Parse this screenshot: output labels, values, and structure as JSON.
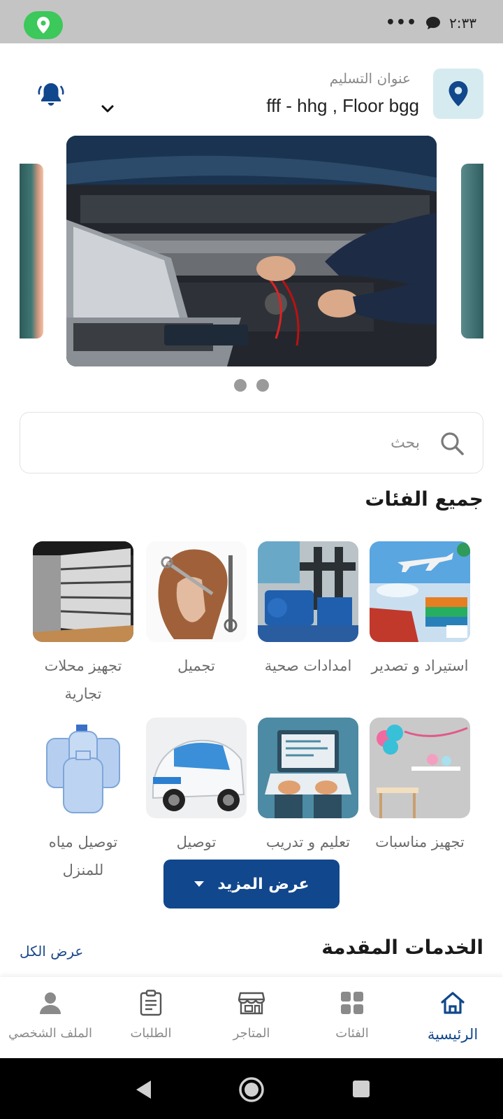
{
  "status_bar": {
    "time": "٢:٣٣",
    "more_dots": "•••",
    "location_badge_icon": "location-pin-icon"
  },
  "header": {
    "address_label": "عنوان التسليم",
    "address_value": "fff - hhg , Floor bgg",
    "notification_icon": "bell-icon",
    "location_icon": "location-pin-icon"
  },
  "carousel": {
    "slide_count": 2
  },
  "search": {
    "placeholder": "بحث"
  },
  "categories": {
    "title": "جميع الفئات",
    "items": [
      {
        "label": "استيراد و تصدير"
      },
      {
        "label": "امدادات صحية"
      },
      {
        "label": "تجميل"
      },
      {
        "label": "تجهيز محلات تجارية"
      },
      {
        "label": "تجهيز مناسبات"
      },
      {
        "label": "تعليم و تدريب"
      },
      {
        "label": "توصيل"
      },
      {
        "label": "توصيل مياه للمنزل"
      }
    ],
    "more_button": "عرض المزيد"
  },
  "services": {
    "title": "الخدمات المقدمة",
    "view_all": "عرض الكل"
  },
  "bottom_nav": {
    "items": [
      {
        "label": "الرئيسية",
        "icon": "home-icon",
        "active": true
      },
      {
        "label": "الفئات",
        "icon": "grid-icon",
        "active": false
      },
      {
        "label": "المتاجر",
        "icon": "store-icon",
        "active": false
      },
      {
        "label": "الطلبات",
        "icon": "clipboard-icon",
        "active": false
      },
      {
        "label": "الملف الشخصي",
        "icon": "person-icon",
        "active": false
      }
    ]
  },
  "colors": {
    "primary": "#11478c",
    "status_green": "#3cc85a",
    "location_bg": "#d6ebf0"
  }
}
